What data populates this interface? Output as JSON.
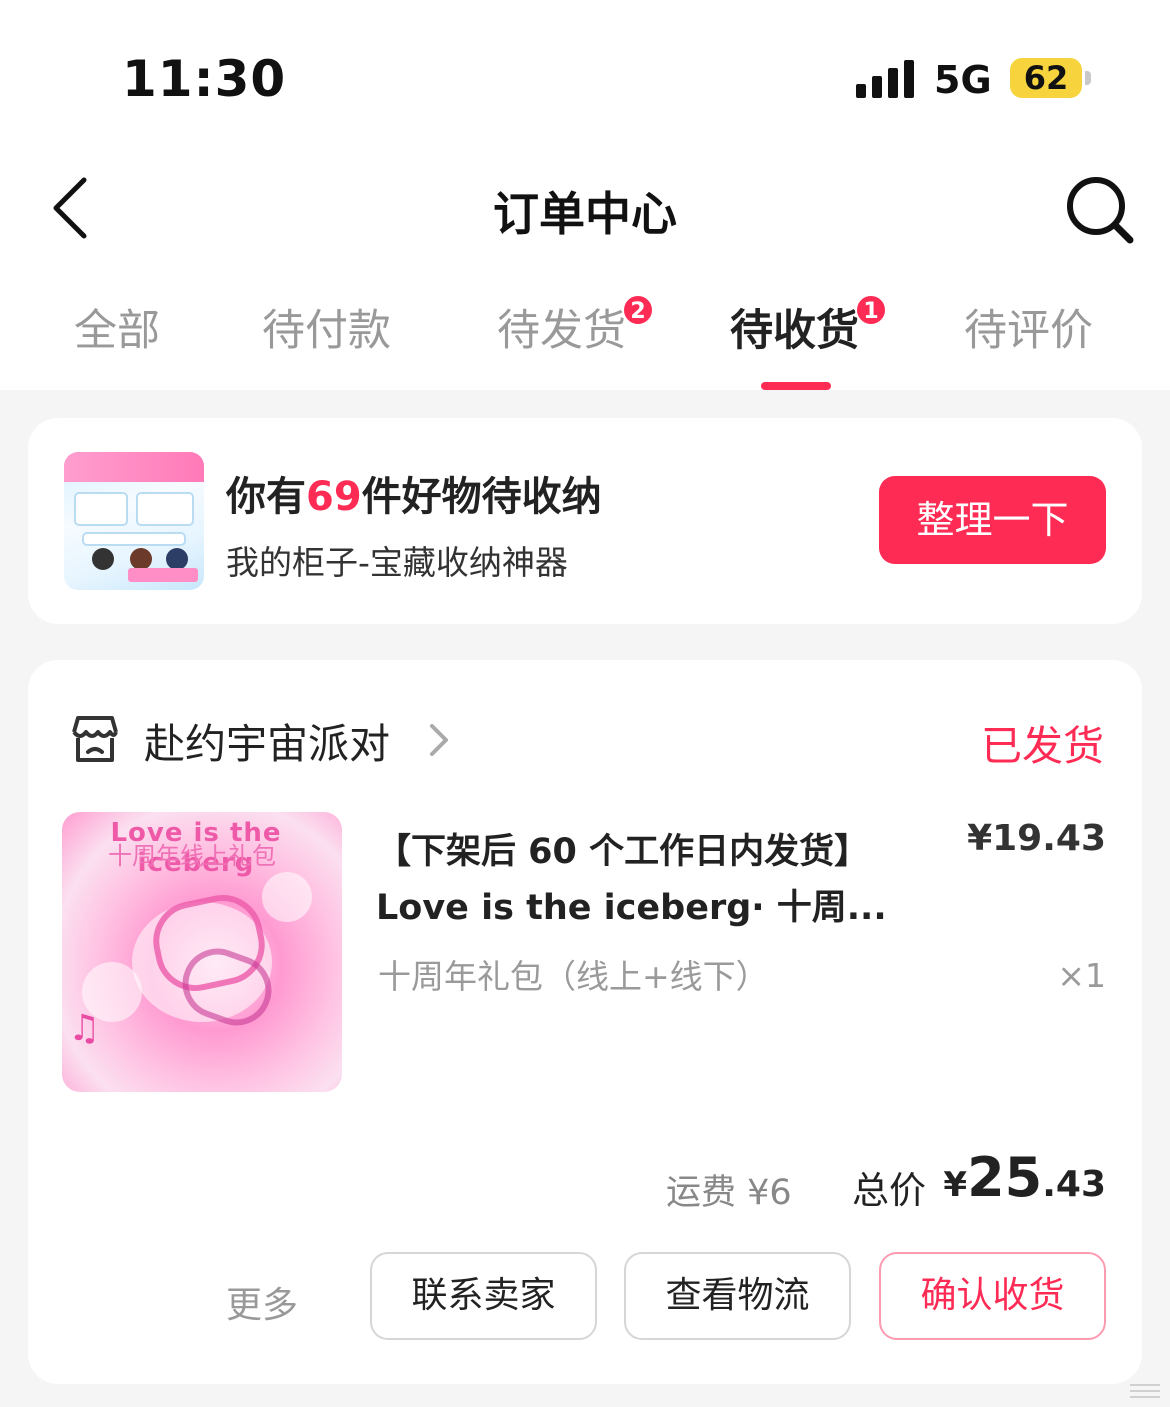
{
  "status_bar": {
    "time": "11:30",
    "network": "5G",
    "battery": "62"
  },
  "header": {
    "title": "订单中心"
  },
  "tabs": [
    {
      "label": "全部",
      "badge": ""
    },
    {
      "label": "待付款",
      "badge": ""
    },
    {
      "label": "待发货",
      "badge": "2"
    },
    {
      "label": "待收货",
      "badge": "1"
    },
    {
      "label": "待评价",
      "badge": ""
    }
  ],
  "active_tab": "待收货",
  "promo": {
    "prefix": "你有",
    "count": "69",
    "suffix": "件好物待收纳",
    "subtitle": "我的柜子-宝藏收纳神器",
    "button": "整理一下"
  },
  "order": {
    "shop_name": "赴约宇宙派对",
    "status": "已发货",
    "product": {
      "title_line1": "【下架后 60 个工作日内发货】",
      "title_line2": "Love is the iceberg· 十周...",
      "price": "¥19.43",
      "spec": "十周年礼包（线上+线下）",
      "quantity": "×1",
      "image_title": "Love is the iceberg",
      "image_subtitle": "十周年线上礼包"
    },
    "shipping": "运费 ¥6",
    "total_label": "总价",
    "total_currency": "¥",
    "total_integer": "25",
    "total_decimal": ".43",
    "more": "更多",
    "buttons": {
      "contact_seller": "联系卖家",
      "view_logistics": "查看物流",
      "confirm_receipt": "确认收货"
    }
  },
  "colors": {
    "accent": "#fe2c55",
    "battery": "#f7d33d",
    "background": "#f5f5f5"
  }
}
